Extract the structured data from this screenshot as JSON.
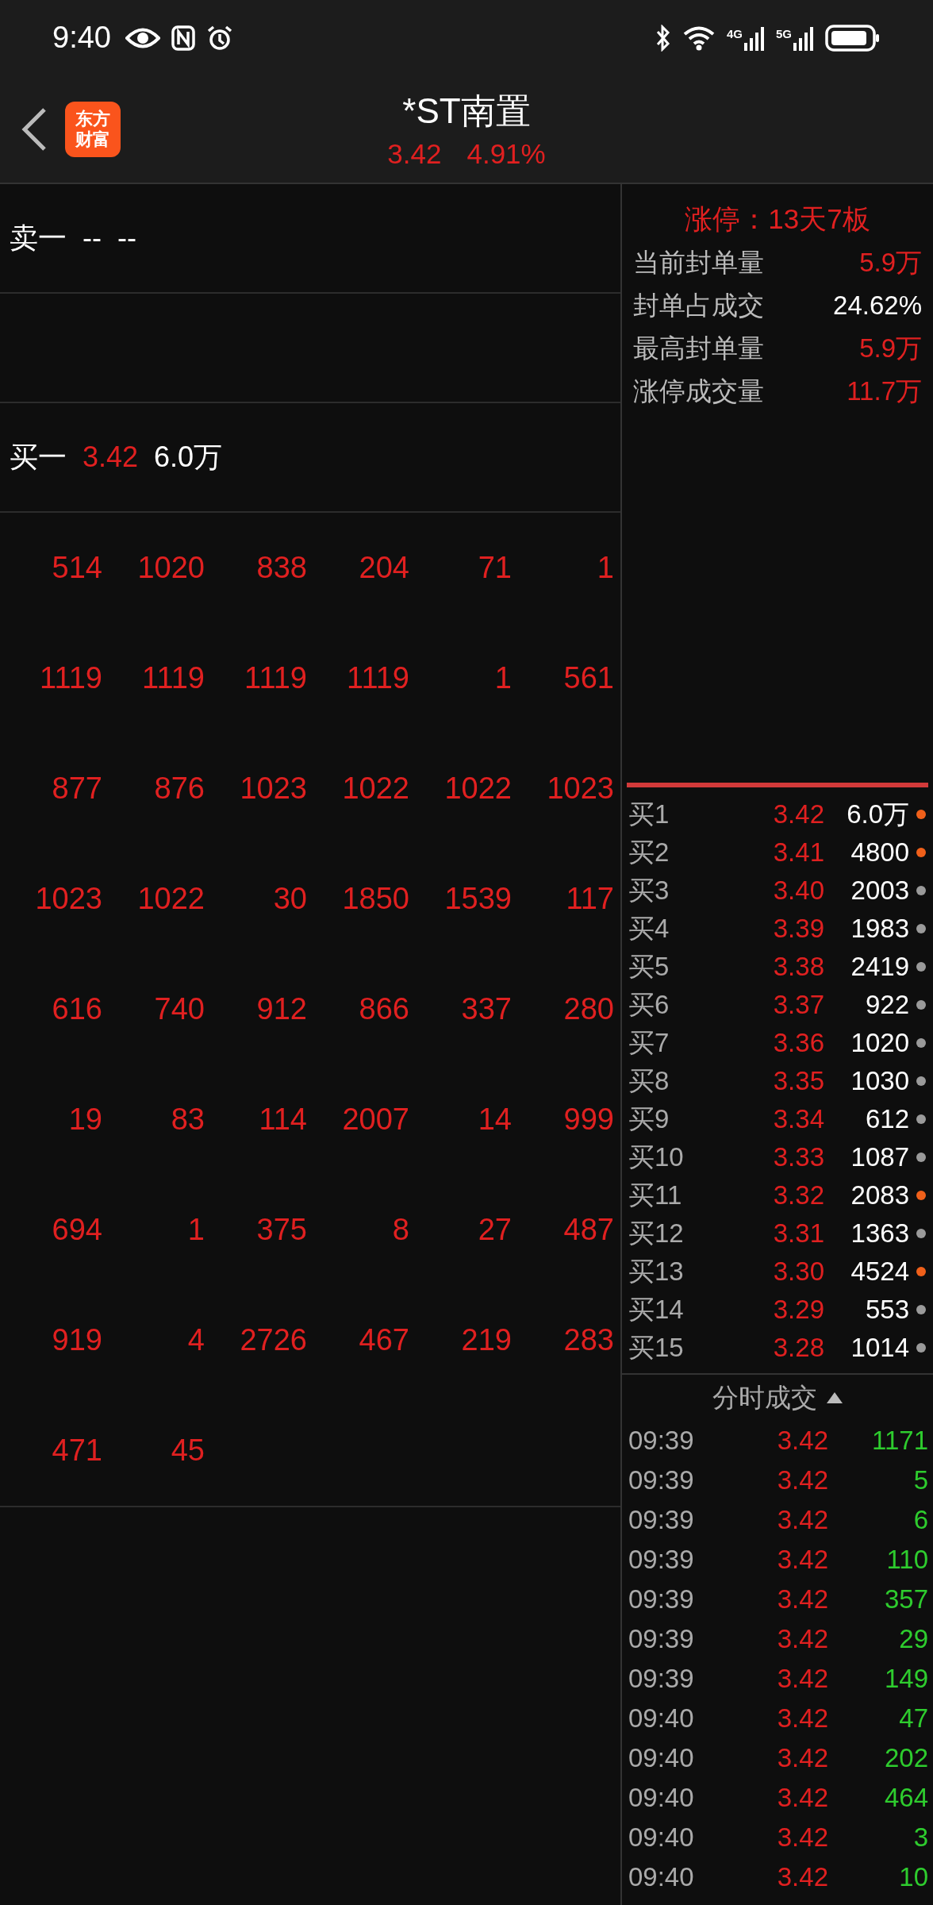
{
  "status_bar": {
    "time": "9:40",
    "network_labels": [
      "4G",
      "5G"
    ]
  },
  "header": {
    "logo_lines": [
      "东方",
      "财富"
    ],
    "title": "*ST南置",
    "price": "3.42",
    "change": "4.91%"
  },
  "order_book": {
    "ask": {
      "label": "卖一",
      "price": "--",
      "volume": "--"
    },
    "bid": {
      "label": "买一",
      "price": "3.42",
      "volume": "6.0万"
    },
    "queue": [
      [
        "514",
        "1020",
        "838",
        "204",
        "71",
        "1"
      ],
      [
        "1119",
        "1119",
        "1119",
        "1119",
        "1",
        "561"
      ],
      [
        "877",
        "876",
        "1023",
        "1022",
        "1022",
        "1023"
      ],
      [
        "1023",
        "1022",
        "30",
        "1850",
        "1539",
        "117"
      ],
      [
        "616",
        "740",
        "912",
        "866",
        "337",
        "280"
      ],
      [
        "19",
        "83",
        "114",
        "2007",
        "14",
        "999"
      ],
      [
        "694",
        "1",
        "375",
        "8",
        "27",
        "487"
      ],
      [
        "919",
        "4",
        "2726",
        "467",
        "219",
        "283"
      ],
      [
        "471",
        "45"
      ]
    ]
  },
  "limit_up": {
    "title": "涨停：13天7板",
    "stats": [
      {
        "label": "当前封单量",
        "value": "5.9万",
        "highlight": true
      },
      {
        "label": "封单占成交",
        "value": "24.62%",
        "highlight": false
      },
      {
        "label": "最高封单量",
        "value": "5.9万",
        "highlight": true
      },
      {
        "label": "涨停成交量",
        "value": "11.7万",
        "highlight": true
      }
    ]
  },
  "bids": [
    {
      "label": "买1",
      "price": "3.42",
      "volume": "6.0万",
      "color": "#f0601a"
    },
    {
      "label": "买2",
      "price": "3.41",
      "volume": "4800",
      "color": "#f0601a"
    },
    {
      "label": "买3",
      "price": "3.40",
      "volume": "2003",
      "color": "#9a9a9a"
    },
    {
      "label": "买4",
      "price": "3.39",
      "volume": "1983",
      "color": "#9a9a9a"
    },
    {
      "label": "买5",
      "price": "3.38",
      "volume": "2419",
      "color": "#9a9a9a"
    },
    {
      "label": "买6",
      "price": "3.37",
      "volume": "922",
      "color": "#9a9a9a"
    },
    {
      "label": "买7",
      "price": "3.36",
      "volume": "1020",
      "color": "#9a9a9a"
    },
    {
      "label": "买8",
      "price": "3.35",
      "volume": "1030",
      "color": "#9a9a9a"
    },
    {
      "label": "买9",
      "price": "3.34",
      "volume": "612",
      "color": "#9a9a9a"
    },
    {
      "label": "买10",
      "price": "3.33",
      "volume": "1087",
      "color": "#9a9a9a"
    },
    {
      "label": "买11",
      "price": "3.32",
      "volume": "2083",
      "color": "#f0601a"
    },
    {
      "label": "买12",
      "price": "3.31",
      "volume": "1363",
      "color": "#9a9a9a"
    },
    {
      "label": "买13",
      "price": "3.30",
      "volume": "4524",
      "color": "#f0601a"
    },
    {
      "label": "买14",
      "price": "3.29",
      "volume": "553",
      "color": "#9a9a9a"
    },
    {
      "label": "买15",
      "price": "3.28",
      "volume": "1014",
      "color": "#9a9a9a"
    }
  ],
  "trades": {
    "title": "分时成交",
    "rows": [
      {
        "time": "09:39",
        "price": "3.42",
        "volume": "1171"
      },
      {
        "time": "09:39",
        "price": "3.42",
        "volume": "5"
      },
      {
        "time": "09:39",
        "price": "3.42",
        "volume": "6"
      },
      {
        "time": "09:39",
        "price": "3.42",
        "volume": "110"
      },
      {
        "time": "09:39",
        "price": "3.42",
        "volume": "357"
      },
      {
        "time": "09:39",
        "price": "3.42",
        "volume": "29"
      },
      {
        "time": "09:39",
        "price": "3.42",
        "volume": "149"
      },
      {
        "time": "09:40",
        "price": "3.42",
        "volume": "47"
      },
      {
        "time": "09:40",
        "price": "3.42",
        "volume": "202"
      },
      {
        "time": "09:40",
        "price": "3.42",
        "volume": "464"
      },
      {
        "time": "09:40",
        "price": "3.42",
        "volume": "3"
      },
      {
        "time": "09:40",
        "price": "3.42",
        "volume": "10"
      }
    ]
  }
}
